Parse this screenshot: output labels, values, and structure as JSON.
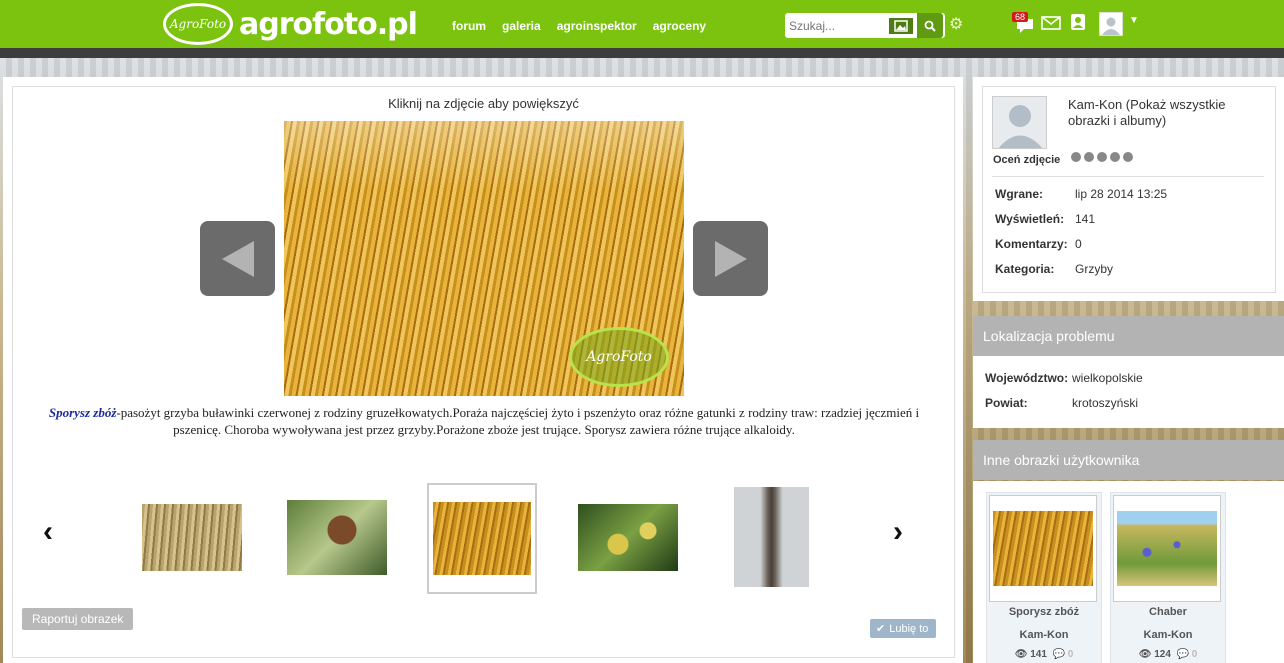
{
  "header": {
    "logo_badge": "AgroFoto",
    "logo_text": "agrofoto.pl",
    "nav": [
      "forum",
      "galeria",
      "agroinspektor",
      "agroceny"
    ],
    "search_placeholder": "Szukaj...",
    "notification_count": "68",
    "accent_color": "#7cc30f"
  },
  "viewer": {
    "hint": "Kliknij na zdjęcie aby powiększyć",
    "watermark": "AgroFoto",
    "description_title": "Sporysz zbóż",
    "description_body": "-pasożyt grzyba buławinki czerwonej z rodziny gruzełkowatych.Poraża najczęściej żyto i pszenżyto oraz różne gatunki z rodziny traw: rzadziej jęczmień i pszenicę. Choroba wywoływana jest przez grzyby.Porażone zboże jest trujące. Sporysz zawiera różne trujące alkaloidy.",
    "report_label": "Raportuj obrazek",
    "like_label": "Lubię to"
  },
  "info": {
    "uploader_text": "Kam-Kon (Pokaż wszystkie obrazki i albumy)",
    "rate_label": "Oceń zdjęcie",
    "rows": [
      {
        "k": "Wgrane:",
        "v": "lip 28 2014 13:25"
      },
      {
        "k": "Wyświetleń:",
        "v": "141"
      },
      {
        "k": "Komentarzy:",
        "v": "0"
      },
      {
        "k": "Kategoria:",
        "v": "Grzyby"
      }
    ]
  },
  "location": {
    "title": "Lokalizacja problemu",
    "rows": [
      {
        "k": "Województwo:",
        "v": "wielkopolskie"
      },
      {
        "k": "Powiat:",
        "v": "krotoszyński"
      }
    ]
  },
  "others": {
    "title": "Inne obrazki użytkownika",
    "cards": [
      {
        "caption": "Sporysz zbóż",
        "user": "Kam-Kon",
        "views": "141",
        "comments": "0"
      },
      {
        "caption": "Chaber",
        "user": "Kam-Kon",
        "views": "124",
        "comments": "0"
      }
    ]
  }
}
